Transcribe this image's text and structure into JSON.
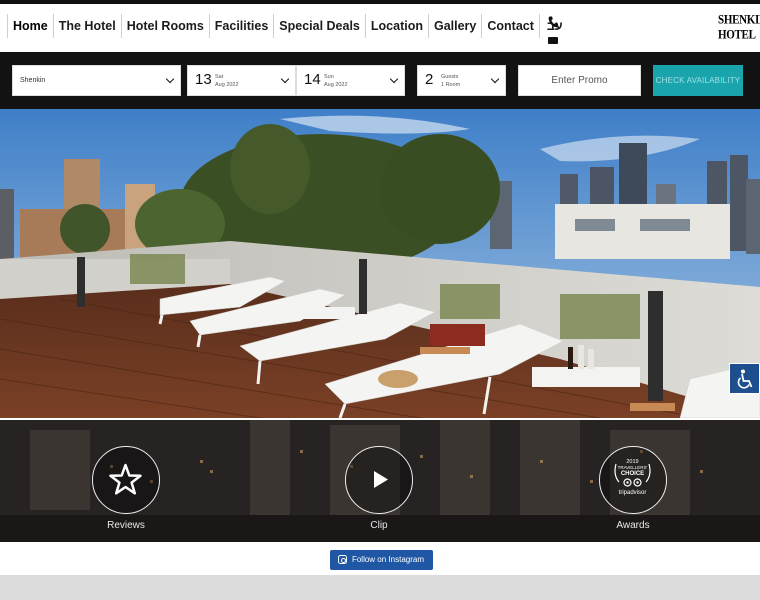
{
  "nav": {
    "items": [
      {
        "label": "Home",
        "active": true
      },
      {
        "label": "The Hotel"
      },
      {
        "label": "Hotel Rooms"
      },
      {
        "label": "Facilities"
      },
      {
        "label": "Special Deals"
      },
      {
        "label": "Location"
      },
      {
        "label": "Gallery"
      },
      {
        "label": "Contact"
      },
      {
        "label": "עב"
      }
    ],
    "icons": [
      "phone-icon",
      "mail-icon"
    ]
  },
  "logo": {
    "line1": "SHENKIN",
    "line2": "HOTEL"
  },
  "booking": {
    "hotel_value": "Shenkin",
    "checkin": {
      "day": "13",
      "weekday": "Sat",
      "month_year": "Aug 2022"
    },
    "checkout": {
      "day": "14",
      "weekday": "Sun",
      "month_year": "Aug 2022"
    },
    "guests": {
      "count": "2",
      "label": "Guests",
      "rooms": "1 Room"
    },
    "promo_placeholder": "Enter Promo",
    "check_label": "CHECK AVAILABILITY",
    "check_color": "#1aa5ad"
  },
  "features": [
    {
      "label": "Reviews",
      "icon": "star-icon"
    },
    {
      "label": "Clip",
      "icon": "play-icon"
    },
    {
      "label": "Awards",
      "icon": "tripadvisor-award-icon"
    }
  ],
  "award": {
    "line1": "2019",
    "line2": "TRAVELLERS'",
    "line3": "CHOICE",
    "brand": "tripadvisor"
  },
  "instagram": {
    "label": "Follow on Instagram",
    "color": "#1f57a5"
  },
  "accessibility": {
    "icon": "accessibility-icon"
  }
}
